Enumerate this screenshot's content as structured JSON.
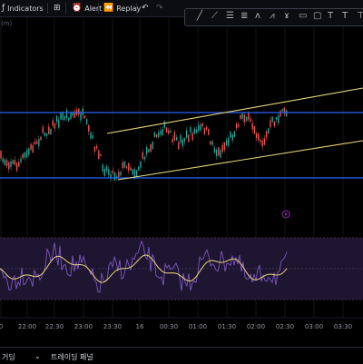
{
  "toolbar": {
    "indicators_label": "Indicators",
    "alert_label": "Alert",
    "replay_label": "Replay",
    "indicators_icon": "function-icon",
    "templates_icon": "grid-icon",
    "alert_icon": "alarm-clock-icon",
    "replay_icon": "rewind-icon",
    "undo_icon": "undo-icon",
    "redo_icon": "redo-icon"
  },
  "drawing_tools": [
    {
      "glyph": "╱",
      "name": "trend-line-icon"
    },
    {
      "glyph": "⟋",
      "name": "ray-icon"
    },
    {
      "glyph": "☰",
      "name": "fib-retracement-icon"
    },
    {
      "glyph": "≣",
      "name": "parallel-channel-icon"
    },
    {
      "glyph": "ʌ",
      "name": "pattern-icon"
    },
    {
      "glyph": "⩘",
      "name": "elliott-wave-icon"
    },
    {
      "glyph": "ɤ",
      "name": "brush-icon"
    },
    {
      "glyph": "▭",
      "name": "rectangle-icon"
    },
    {
      "glyph": "▢",
      "name": "shape-icon"
    },
    {
      "glyph": "T",
      "name": "text-icon"
    },
    {
      "glyph": "T",
      "name": "note-icon"
    },
    {
      "glyph": "⊤",
      "name": "anchored-text-icon"
    }
  ],
  "indicator_label": "(m)",
  "time_axis": {
    "labels": [
      "0",
      "22:00",
      "22:30",
      "23:00",
      "23:30",
      "16",
      "00:30",
      "01:00",
      "01:30",
      "02:00",
      "02:30",
      "03:00",
      "03:30"
    ]
  },
  "bottom_tabs": {
    "tab1": "거딩",
    "tab2": "트레이딩 패널"
  },
  "colors": {
    "background": "#000000",
    "candle_up": "#26a69a",
    "candle_down": "#ef5350",
    "horizontal_levels": "#2962ff",
    "channel_lines": "#e6d57a",
    "oscillator_line": "#7e57c2",
    "oscillator_signal": "#e6d57a",
    "oscillator_band": "#1e1530"
  }
}
